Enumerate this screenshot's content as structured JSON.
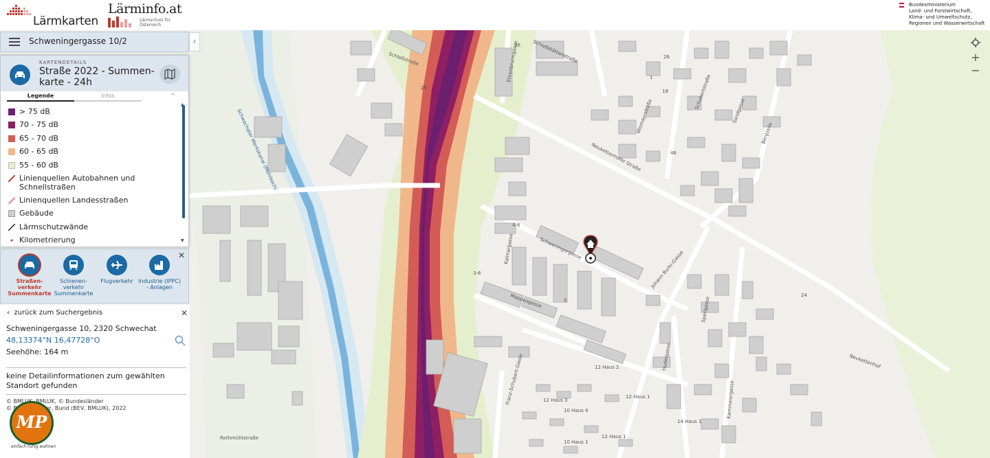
{
  "header": {
    "logo_laermkarten": "Lärmkarten",
    "logo_laerminfo": "Lärminfo.at",
    "logo_laerminfo_sub": "Lärmschutz für Österreich",
    "ministry": [
      "Bundesministerium",
      "Land- und Forstwirtschaft,",
      "Klima- und Umweltschutz,",
      "Regionen und Wasserwirtschaft"
    ]
  },
  "search": {
    "query": "Schweningergasse 10/2"
  },
  "legend_panel": {
    "overline": "KARTENDETAILS",
    "title": "Straße 2022 - Summen-karte - 24h",
    "tab_legend": "Legende",
    "tab_info": "Infos",
    "items": [
      {
        "label": "> 75 dB",
        "color": "#6b1f6e"
      },
      {
        "label": "70 - 75 dB",
        "color": "#8e1f63"
      },
      {
        "label": "65 - 70 dB",
        "color": "#d45c56"
      },
      {
        "label": "60 - 65 dB",
        "color": "#f0b88a"
      },
      {
        "label": "55 - 60 dB",
        "color": "#e6efcd"
      },
      {
        "label": "Linienquellen Autobahnen und Schnellstraßen",
        "color": "#c0392b"
      },
      {
        "label": "Linienquellen Landesstraßen",
        "color": "#e8a0a0"
      },
      {
        "label": "Gebäude",
        "color": "#cfcfcf"
      },
      {
        "label": "Lärmschutzwände",
        "color": "#222222"
      },
      {
        "label": "Kilometrierung",
        "color": "#c0392b"
      }
    ]
  },
  "sources": [
    {
      "label": "Straßen-verkehr Summenkarte",
      "icon": "car-icon"
    },
    {
      "label": "Schienen-verkehr Summenkarte",
      "icon": "train-icon"
    },
    {
      "label": "Flugverkehr",
      "icon": "plane-icon"
    },
    {
      "label": "Industrie (IPPC) - Anlagen",
      "icon": "factory-icon"
    }
  ],
  "info": {
    "back": "zurück zum Suchergebnis",
    "address": "Schweningergasse 10, 2320 Schwechat",
    "coords": "48,13374°N 16,47728°O",
    "height": "Seehöhe: 164 m",
    "no_detail": "keine Detailinformationen zum gewählten Standort gefunden",
    "copyright1": "© BMLUK, BMLUK, © Bundesländer",
    "copyright2": "© Bundesländer, Bund (BEV, BMLUK), 2022",
    "mp_logo": "MP",
    "mp_tag": "einfach ruhig wohnen"
  },
  "map_labels": {
    "streets": [
      "Schießstättenstraße",
      "Schloßstraße",
      "Neukettenhofer Straße",
      "Wismayrstraße",
      "Schubertstraße",
      "Sandgasse",
      "Bergzeile",
      "Schweningergasse",
      "Kalmargasse",
      "Mappesgasse",
      "Johann Burki-Gasse",
      "Sperlgasse",
      "Hudelgasse",
      "Kammeiergasse",
      "Franz-Schubert-Gasse",
      "Rothmühlstraße",
      "Ehrenbrunngasse",
      "Schwechater Werkskanal (Mühlbach)",
      "Neukettenhof"
    ],
    "house_numbers": [
      "36",
      "26",
      "18",
      "1",
      "46",
      "26",
      "10",
      "5",
      "4-6",
      "3-6",
      "24",
      "12 Haus 2",
      "12 Haus 1",
      "12 Haus 3",
      "10 Haus 4",
      "10 Haus 1",
      "14 Haus 1",
      "12 Haus 1"
    ]
  },
  "colors": {
    "accent": "#1b6aa5",
    "road_core": "#6b1f6e",
    "noise_70": "#8e1f63",
    "noise_65": "#d45c56",
    "noise_60": "#f0b88a",
    "noise_55": "#e6efcd",
    "forest": "#e8f2d6"
  },
  "icons": [
    "menu-icon",
    "map-icon",
    "home-pin-icon",
    "search-icon",
    "locate-icon",
    "zoom-in-icon",
    "zoom-out-icon",
    "close-icon",
    "chevron-left-icon"
  ]
}
